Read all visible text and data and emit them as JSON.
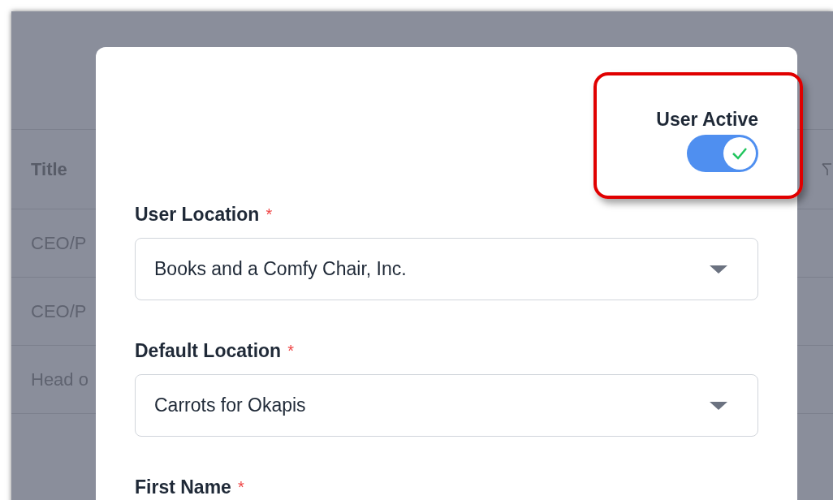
{
  "background_table": {
    "header": "Title",
    "rows": [
      "CEO/P",
      "CEO/P",
      "Head o"
    ]
  },
  "modal": {
    "user_active": {
      "label": "User Active",
      "on": true,
      "highlighted": true
    },
    "fields": [
      {
        "kind": "select",
        "label": "User Location",
        "required_mark": "*",
        "value": "Books and a Comfy Chair, Inc."
      },
      {
        "kind": "select",
        "label": "Default Location",
        "required_mark": "*",
        "value": "Carrots for Okapis"
      },
      {
        "kind": "label",
        "label": "First Name",
        "required_mark": "*"
      }
    ]
  }
}
